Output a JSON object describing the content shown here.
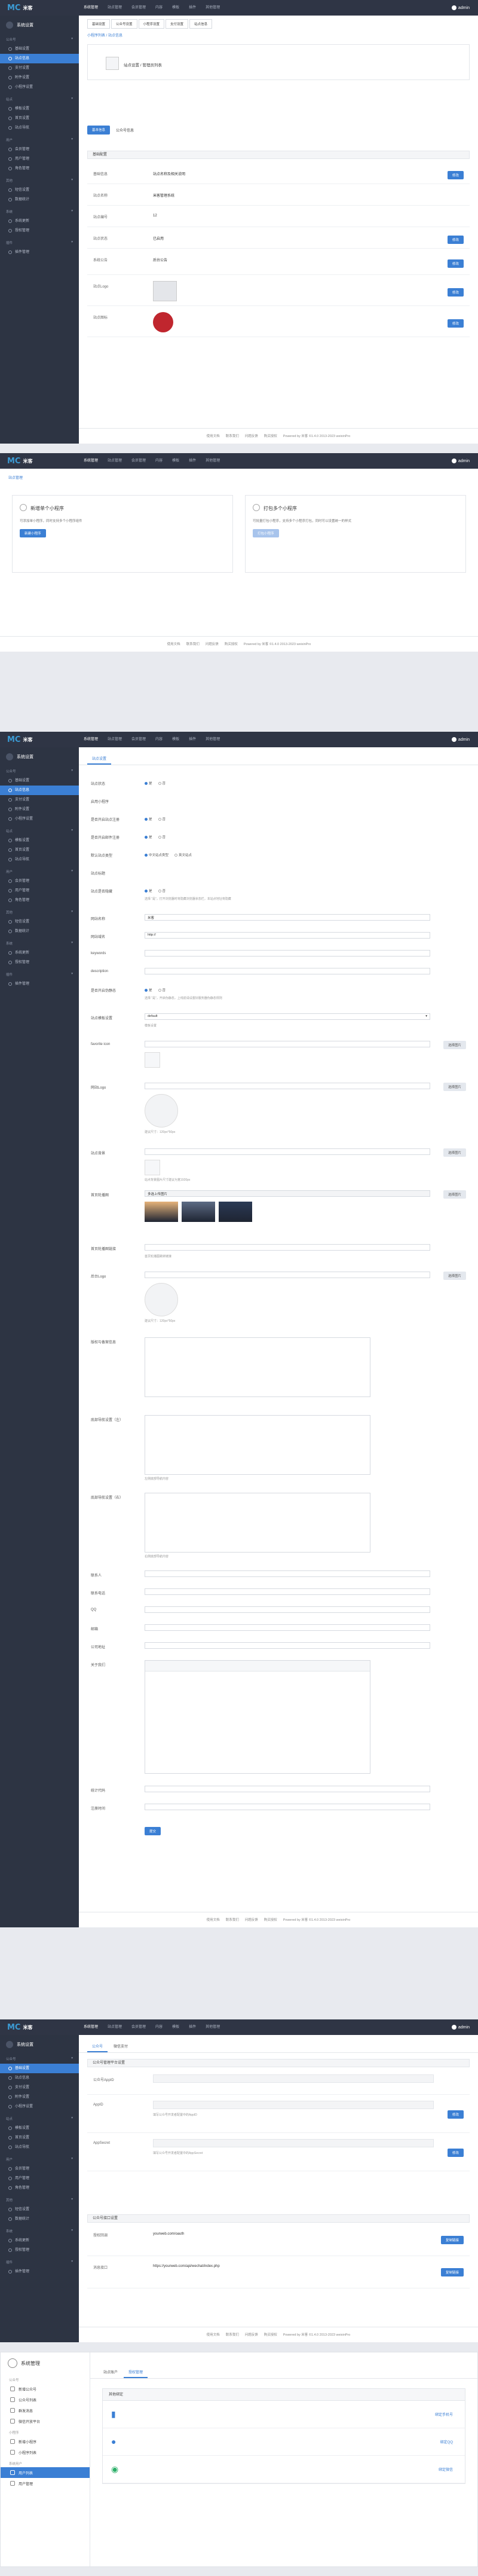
{
  "brand": {
    "mark": "MC",
    "text": "米客"
  },
  "top_nav": [
    "系统管理",
    "站点管理",
    "会员管理",
    "内容",
    "模板",
    "插件",
    "其他管理"
  ],
  "user": "admin",
  "footer": {
    "links": [
      "使用文档",
      "联系我们",
      "问题反馈",
      "购买授权"
    ],
    "copy": "Powered by 米客 ©1.4.0 2013-2023 weixinPro"
  },
  "s1": {
    "sidebar_title": "系统设置",
    "sidebar_groups": [
      {
        "label": "公众号",
        "items": [
          "基础设置",
          "站点信息",
          "支付设置",
          "附件设置",
          "小程序设置"
        ]
      },
      {
        "label": "站点",
        "items": [
          "模板设置",
          "首页设置",
          "站点导航"
        ]
      },
      {
        "label": "用户",
        "items": [
          "会员管理",
          "用户管理",
          "角色管理"
        ]
      },
      {
        "label": "其他",
        "items": [
          "短信设置",
          "数据统计"
        ]
      },
      {
        "label": "系统",
        "items": [
          "系统更新",
          "授权管理"
        ]
      },
      {
        "label": "插件",
        "items": [
          "插件管理"
        ]
      }
    ],
    "active_item": "站点信息",
    "top_tabs": [
      "基础设置",
      "公众号设置",
      "小程序设置",
      "支付设置",
      "站点信息"
    ],
    "breadcrumb": "小程序列表 / 站点信息",
    "info_title": "站点设置 / 管理员列表",
    "sub_tabs": [
      "基本信息",
      "公众号信息"
    ],
    "section_title": "基础配置",
    "rows": [
      {
        "label": "基础信息",
        "value": "站点名称及相关说明",
        "action": "修改"
      },
      {
        "label": "站点名称",
        "value": "米客管理系统",
        "action": ""
      },
      {
        "label": "站点编号",
        "value": "12",
        "action": ""
      },
      {
        "label": "站点状态",
        "value": "已启用",
        "action": "修改"
      },
      {
        "label": "系统公告",
        "value": "后台公告",
        "action": "修改"
      },
      {
        "label": "站点Logo",
        "value": "",
        "action": "修改"
      },
      {
        "label": "站点图标",
        "value": "",
        "action": "修改"
      }
    ]
  },
  "s2": {
    "breadcrumb": "站点管理",
    "card1": {
      "title": "新增单个小程序",
      "desc": "可添加单小程序，同时支持多个小程序组件",
      "button": "新建小程序"
    },
    "card2": {
      "title": "打包多个小程序",
      "desc": "可批量打包小程序，支持多个小程序打包，同时可以设置统一的样式",
      "button": "打包小程序"
    }
  },
  "s3": {
    "tab": "站点设置",
    "fields": [
      {
        "label": "站点状态",
        "type": "radio",
        "options": [
          "是",
          "否"
        ],
        "selected": 0
      },
      {
        "label": "启用小程序",
        "type": "text",
        "value": ""
      },
      {
        "label": "是否开启站点注册",
        "type": "radio",
        "options": [
          "是",
          "否"
        ],
        "selected": 0
      },
      {
        "label": "是否开启邮件注册",
        "type": "radio",
        "options": [
          "是",
          "否"
        ],
        "selected": 0
      },
      {
        "label": "默认站点类型",
        "type": "radio",
        "options": [
          "中文站点类型",
          "英文站点"
        ],
        "selected": 0
      },
      {
        "label": "站点标题",
        "type": "text",
        "value": ""
      },
      {
        "label": "站点是否隐藏",
        "type": "radio",
        "options": [
          "是",
          "否"
        ],
        "selected": 0,
        "hint": "选择 “是”，打开浏览器时将隐藏浏览器状态栏，本站点地址将隐藏"
      },
      {
        "label": "网站名称",
        "type": "input",
        "value": "米客"
      },
      {
        "label": "网站域名",
        "type": "input",
        "value": "http://"
      },
      {
        "label": "keywords",
        "type": "input",
        "value": ""
      },
      {
        "label": "description",
        "type": "input",
        "value": ""
      },
      {
        "label": "是否开启伪静态",
        "type": "radio",
        "options": [
          "是",
          "否"
        ],
        "selected": 0,
        "hint": "选择 “是”，开启伪静态，上线前请设置好服务器伪静态规则"
      },
      {
        "label": "站点模板设置",
        "type": "select",
        "value": "default",
        "hint": "模板设置"
      },
      {
        "label": "favorite icon",
        "type": "upload",
        "value": "",
        "button": "选择图片"
      },
      {
        "label": "网站Logo",
        "type": "image",
        "button": "选择图片",
        "hint": "建议尺寸：120px*50px"
      },
      {
        "label": "站点背景",
        "type": "upload",
        "value": "",
        "button": "选择图片",
        "hint": "站点背景图片尺寸建议为宽1920px"
      },
      {
        "label": "首页轮播图",
        "type": "gallery",
        "value": "多选上传图片",
        "button": "选择图片"
      },
      {
        "label": "首页轮播图链接",
        "type": "input",
        "value": "",
        "hint": "首页轮播图跳转链接"
      },
      {
        "label": "后台Logo",
        "type": "image",
        "button": "选择图片",
        "hint": "建议尺寸：120px*50px"
      },
      {
        "label": "版权与备案信息",
        "type": "textarea",
        "value": ""
      },
      {
        "label": "底部导航设置（左）",
        "type": "textarea",
        "value": "",
        "hint": "左侧底部导航内容"
      },
      {
        "label": "底部导航设置（右）",
        "type": "textarea",
        "value": "",
        "hint": "右侧底部导航内容"
      },
      {
        "label": "联系人",
        "type": "input",
        "value": ""
      },
      {
        "label": "联系电话",
        "type": "input",
        "value": ""
      },
      {
        "label": "QQ",
        "type": "input",
        "value": ""
      },
      {
        "label": "邮箱",
        "type": "input",
        "value": ""
      },
      {
        "label": "公司地址",
        "type": "input",
        "value": ""
      },
      {
        "label": "关于我们",
        "type": "editor",
        "value": ""
      },
      {
        "label": "统计代码",
        "type": "input",
        "value": ""
      },
      {
        "label": "注册时间",
        "type": "daterange",
        "value": ""
      }
    ],
    "submit": "提交"
  },
  "s4": {
    "tabs": [
      "公众号",
      "微信支付"
    ],
    "section1": "公众号管理平台设置",
    "rows1": [
      {
        "label": "公众号AppID",
        "value": "",
        "action": ""
      },
      {
        "label": "AppID",
        "value": "",
        "hint": "填写公众号开发者配置中的AppID",
        "action": "修改"
      },
      {
        "label": "AppSecret",
        "value": "",
        "hint": "填写公众号开发者配置中的AppSecret",
        "action": "修改"
      }
    ],
    "section2": "公众号接口设置",
    "rows2": [
      {
        "label": "授权回调",
        "value": "yourweb.com/oauth",
        "action": "复制链接"
      },
      {
        "label": "消息接口",
        "value": "https://yourweb.com/api/wechat/index.php",
        "action": "复制链接"
      }
    ]
  },
  "s5": {
    "title": "系统管理",
    "groups": [
      {
        "label": "公众号",
        "items": [
          "新增公众号",
          "公众号列表",
          "群发消息",
          "微信开放平台"
        ]
      },
      {
        "label": "小程序",
        "items": [
          "新增小程序",
          "小程序列表"
        ]
      },
      {
        "label": "系统用户",
        "items": [
          "用户列表",
          "用户管理"
        ]
      }
    ],
    "active_item": "用户列表",
    "tabs": [
      "站点账户",
      "授权管理"
    ],
    "section": "其他绑定",
    "bindings": [
      {
        "icon": "phone-icon",
        "action": "绑定手机号"
      },
      {
        "icon": "person-icon",
        "action": "绑定QQ"
      },
      {
        "icon": "wechat-icon",
        "action": "绑定微信"
      }
    ]
  },
  "colors": {
    "accent": "#3b7fd4",
    "sidebar": "#2d3443",
    "topbar": "#2f3545"
  }
}
